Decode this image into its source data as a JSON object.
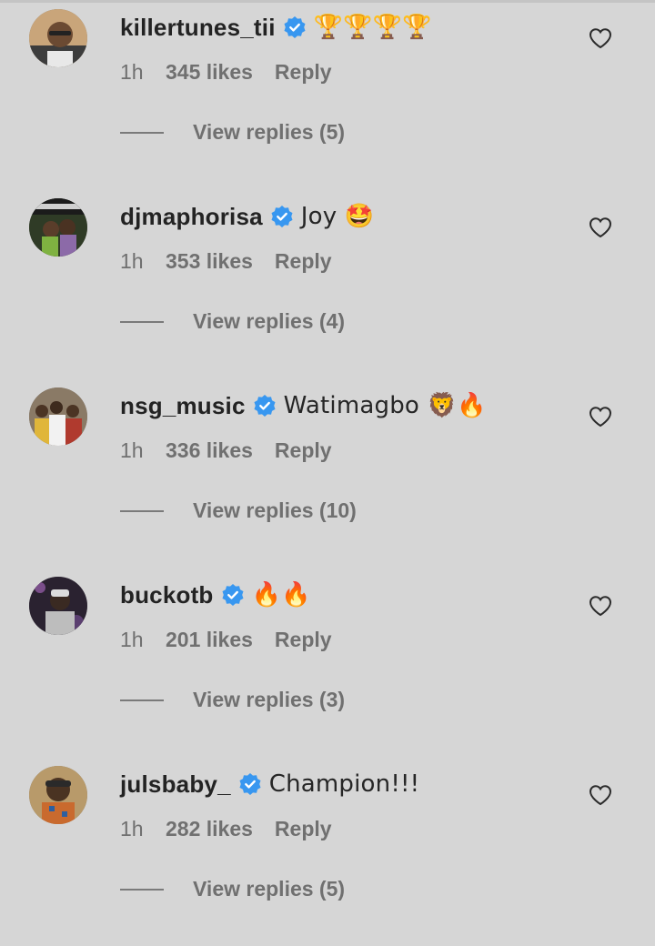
{
  "comments": [
    {
      "username": "killertunes_tii",
      "text": "🏆🏆🏆🏆",
      "time": "1h",
      "likes": "345 likes",
      "reply": "Reply",
      "view_replies": "View replies (5)",
      "verified": true
    },
    {
      "username": "djmaphorisa",
      "text": "Joy 🤩",
      "time": "1h",
      "likes": "353 likes",
      "reply": "Reply",
      "view_replies": "View replies (4)",
      "verified": true
    },
    {
      "username": "nsg_music",
      "text": "Watimagbo 🦁🔥",
      "time": "1h",
      "likes": "336 likes",
      "reply": "Reply",
      "view_replies": "View replies (10)",
      "verified": true
    },
    {
      "username": "buckotb",
      "text": "🔥🔥",
      "time": "1h",
      "likes": "201 likes",
      "reply": "Reply",
      "view_replies": "View replies (3)",
      "verified": true
    },
    {
      "username": "julsbaby_",
      "text": "Champion!!!",
      "time": "1h",
      "likes": "282 likes",
      "reply": "Reply",
      "view_replies": "View replies (5)",
      "verified": true
    }
  ],
  "icons": {
    "verified": "verified-badge-icon",
    "like": "heart-outline-icon"
  },
  "colors": {
    "background": "#d6d6d6",
    "verified_blue": "#3897f0",
    "username": "#232323",
    "meta_text": "#707070"
  }
}
